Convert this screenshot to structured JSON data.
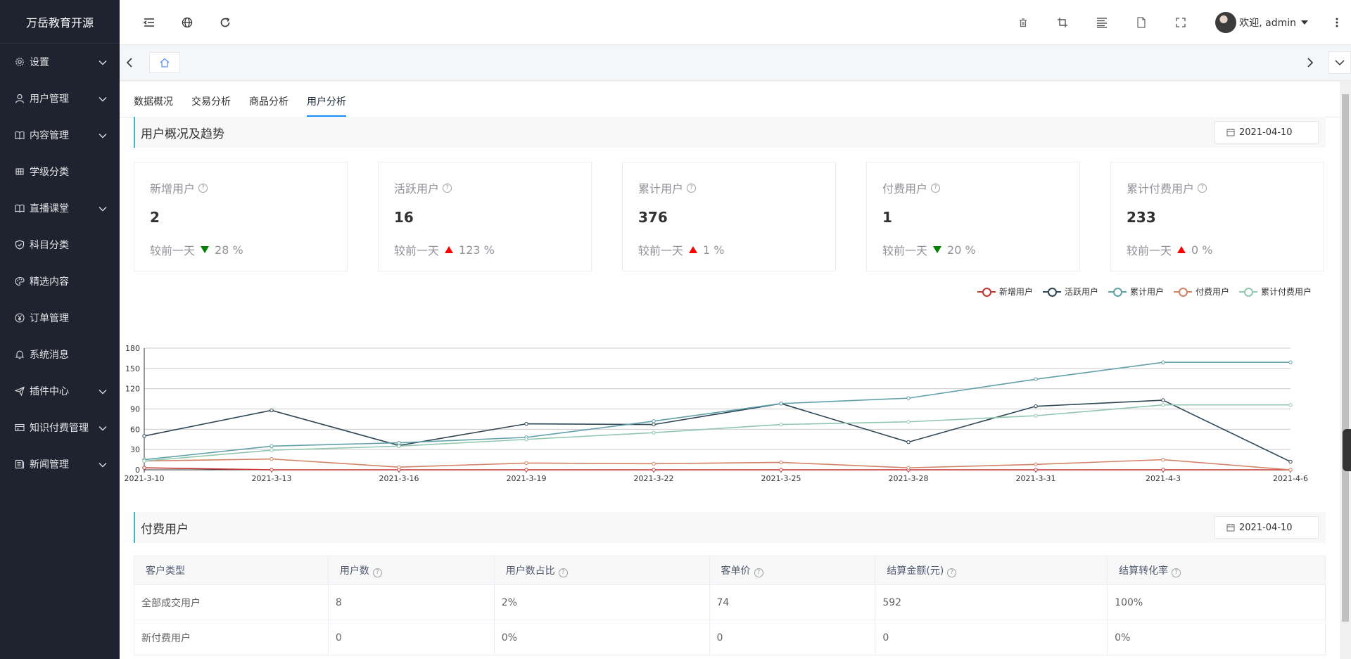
{
  "app": {
    "title": "万岳教育开源"
  },
  "sidebar": {
    "items": [
      {
        "label": "设置",
        "icon": "gear-icon",
        "chevron": true
      },
      {
        "label": "用户管理",
        "icon": "user-icon",
        "chevron": true
      },
      {
        "label": "内容管理",
        "icon": "book-icon",
        "chevron": true
      },
      {
        "label": "学级分类",
        "icon": "grid-icon",
        "chevron": false
      },
      {
        "label": "直播课堂",
        "icon": "book-icon",
        "chevron": true
      },
      {
        "label": "科目分类",
        "icon": "shield-icon",
        "chevron": false
      },
      {
        "label": "精选内容",
        "icon": "palette-icon",
        "chevron": false
      },
      {
        "label": "订单管理",
        "icon": "yen-icon",
        "chevron": false
      },
      {
        "label": "系统消息",
        "icon": "bell-icon",
        "chevron": false
      },
      {
        "label": "插件中心",
        "icon": "send-icon",
        "chevron": true
      },
      {
        "label": "知识付费管理",
        "icon": "card-icon",
        "chevron": true
      },
      {
        "label": "新闻管理",
        "icon": "news-icon",
        "chevron": true
      }
    ]
  },
  "header": {
    "welcome": "欢迎, admin"
  },
  "tabs": [
    {
      "label": "数据概况",
      "active": false
    },
    {
      "label": "交易分析",
      "active": false
    },
    {
      "label": "商品分析",
      "active": false
    },
    {
      "label": "用户分析",
      "active": true
    }
  ],
  "overview": {
    "title": "用户概况及趋势",
    "date": "2021-04-10",
    "compare_label": "较前一天",
    "cards": [
      {
        "title": "新增用户",
        "value": "2",
        "trend": "down",
        "change": "28 %"
      },
      {
        "title": "活跃用户",
        "value": "16",
        "trend": "up",
        "change": "123 %"
      },
      {
        "title": "累计用户",
        "value": "376",
        "trend": "up",
        "change": "1 %"
      },
      {
        "title": "付费用户",
        "value": "1",
        "trend": "down",
        "change": "20 %"
      },
      {
        "title": "累计付费用户",
        "value": "233",
        "trend": "up",
        "change": "0 %"
      }
    ]
  },
  "chart_data": {
    "type": "line",
    "x": [
      "2021-3-10",
      "2021-3-13",
      "2021-3-16",
      "2021-3-19",
      "2021-3-22",
      "2021-3-25",
      "2021-3-28",
      "2021-3-31",
      "2021-4-3",
      "2021-4-6"
    ],
    "ylim": [
      0,
      180
    ],
    "yticks": [
      0,
      30,
      60,
      90,
      120,
      150,
      180
    ],
    "grid": true,
    "legend_position": "top-right",
    "series": [
      {
        "name": "新增用户",
        "color": "#c23531",
        "values": [
          3,
          0,
          0,
          0,
          0,
          0,
          0,
          0,
          0,
          0
        ]
      },
      {
        "name": "活跃用户",
        "color": "#2f4554",
        "values": [
          50,
          88,
          36,
          68,
          67,
          98,
          41,
          94,
          103,
          12
        ]
      },
      {
        "name": "累计用户",
        "color": "#61a0a8",
        "values": [
          15,
          35,
          40,
          48,
          72,
          98,
          106,
          134,
          159,
          159
        ]
      },
      {
        "name": "付费用户",
        "color": "#d48265",
        "values": [
          13,
          16,
          4,
          10,
          9,
          11,
          3,
          8,
          15,
          0
        ]
      },
      {
        "name": "累计付费用户",
        "color": "#91c7ae",
        "values": [
          13,
          29,
          35,
          45,
          55,
          67,
          71,
          80,
          96,
          96
        ]
      }
    ]
  },
  "paid": {
    "title": "付费用户",
    "date": "2021-04-10",
    "columns": [
      "客户类型",
      "用户数",
      "用户数占比",
      "客单价",
      "结算金额(元)",
      "结算转化率"
    ],
    "rows": [
      [
        "全部成交用户",
        "8",
        "2%",
        "74",
        "592",
        "100%"
      ],
      [
        "新付费用户",
        "0",
        "0%",
        "0",
        "0",
        "0%"
      ]
    ]
  }
}
